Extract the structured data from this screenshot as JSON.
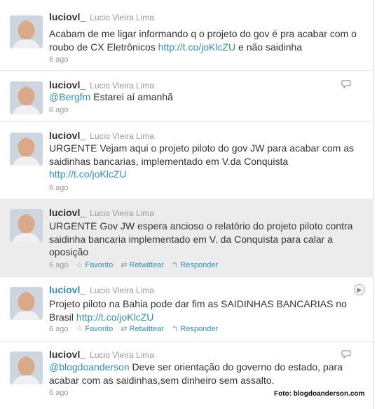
{
  "tweets": [
    {
      "handle": "luciovl_",
      "name": "Lucio Vieira Lima",
      "pre": "Acabam de me ligar informando q o projeto do gov é pra acabar com o roubo de CX Eletrônicos",
      "link": "http://t.co/joKlcZU",
      "post": "e não saidinha",
      "time": "6 ago"
    },
    {
      "handle": "luciovl_",
      "name": "Lucio Vieira Lima",
      "mention": "@Bergfm",
      "text": "Estarei aí amanhã",
      "time": "6 ago"
    },
    {
      "handle": "luciovl_",
      "name": "Lucio Vieira Lima",
      "text": "URGENTE Vejam aqui o projeto piloto do gov JW para acabar com as saidinhas bancarias, implementado em V.da Conquista",
      "link": "http://t.co/joKlcZU",
      "time": "6 ago"
    },
    {
      "handle": "luciovl_",
      "name": "Lucio Vieira Lima",
      "text": "URGENTE Gov JW espera ancioso o relatório do projeto piloto contra saidinha bancaria implementado em V. da Conquista para calar a oposição",
      "time": "6 ago",
      "actions": {
        "favorite": "Favorito",
        "retweet": "Retwittear",
        "reply": "Responder"
      }
    },
    {
      "handle": "luciovl_",
      "name": "Lucio Vieira Lima",
      "text": "Projeto piloto na Bahia pode dar fim as SAIDINHAS BANCARIAS no Brasil",
      "link": "http://t.co/joKlcZU",
      "time": "6 ago",
      "actions": {
        "favorite": "Favorito",
        "retweet": "Retwittear",
        "reply": "Responder"
      }
    },
    {
      "handle": "luciovl_",
      "name": "Lucio Vieira Lima",
      "mention": "@blogdoanderson",
      "text": "Deve ser orientação do governo do estado, para acabar com as saidinhas,sem dinheiro sem assalto.",
      "time": "6 ago"
    }
  ],
  "credit": "Foto: blogdoanderson.com",
  "icons": {
    "reply": "speech-bubble-icon",
    "expand": "chevron-right-icon",
    "favorite": "star-icon",
    "retweet": "retweet-icon"
  },
  "colors": {
    "link": "#2f8fb8",
    "highlight": "#ececec",
    "muted": "#999999"
  }
}
